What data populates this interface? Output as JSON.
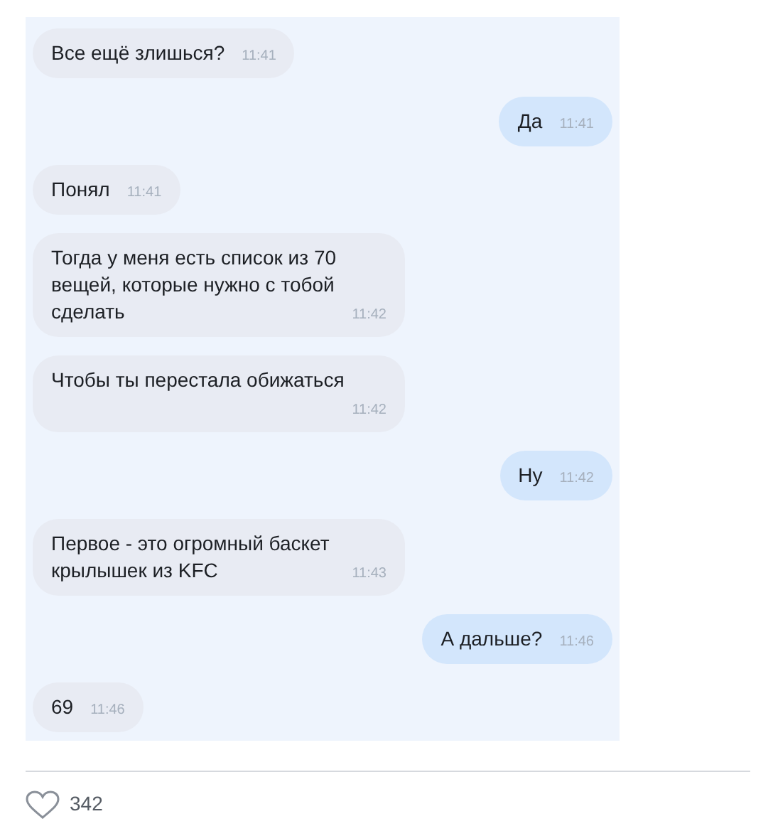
{
  "messages": [
    {
      "text": "Все ещё злишься?",
      "time": "11:41",
      "outgoing": false
    },
    {
      "text": "Да",
      "time": "11:41",
      "outgoing": true
    },
    {
      "text": "Понял",
      "time": "11:41",
      "outgoing": false
    },
    {
      "text": "Тогда у меня есть список из 70 вещей, которые нужно с тобой сделать",
      "time": "11:42",
      "outgoing": false
    },
    {
      "text": "Чтобы ты перестала обижаться",
      "time": "11:42",
      "outgoing": false
    },
    {
      "text": "Ну",
      "time": "11:42",
      "outgoing": true
    },
    {
      "text": "Первое - это огромный баскет крылышек из KFC",
      "time": "11:43",
      "outgoing": false
    },
    {
      "text": "А дальше?",
      "time": "11:46",
      "outgoing": true
    },
    {
      "text": "69",
      "time": "11:46",
      "outgoing": false
    }
  ],
  "likes": {
    "count": "342",
    "liked": false
  }
}
